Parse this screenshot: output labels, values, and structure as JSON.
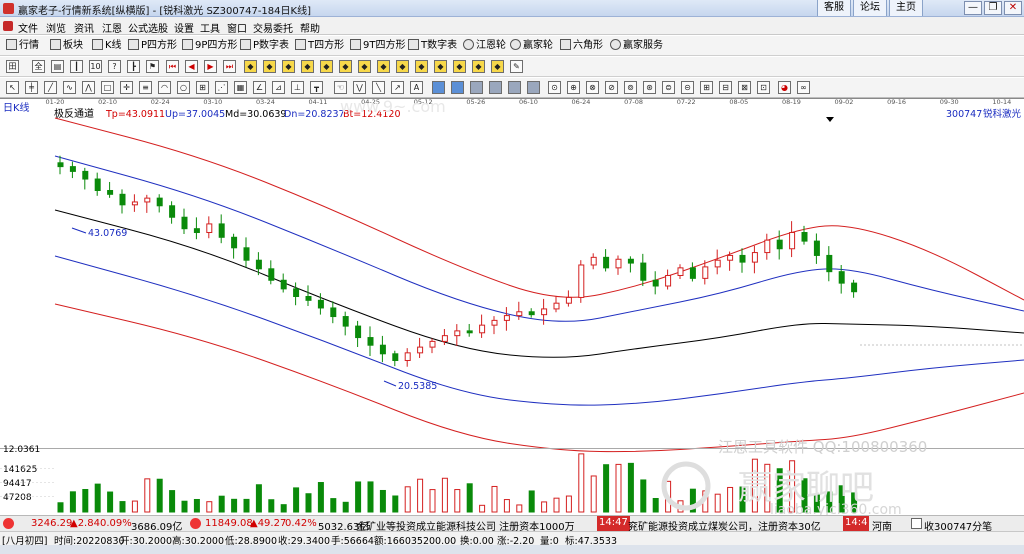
{
  "titlebar": {
    "title": "赢家老子-行情新系统[纵横版] - [锐科激光 SZ300747-184日K线]",
    "buttons": [
      "客服",
      "论坛",
      "主页"
    ],
    "win_min": "—",
    "win_restore": "❐",
    "win_close": "✕"
  },
  "menu": [
    "文件",
    "浏览",
    "资讯",
    "江恩",
    "公式选股",
    "设置",
    "工具",
    "窗口",
    "交易委托",
    "帮助"
  ],
  "toolbar1": [
    "行情",
    "板块",
    "K线",
    "P四方形",
    "9P四方形",
    "P数字表",
    "T四方形",
    "9T四方形",
    "T数字表",
    "江恩轮",
    "赢家轮",
    "六角形",
    "赢家服务"
  ],
  "toolbar2_text": [
    "全",
    "10",
    "?"
  ],
  "toolbar3_text": [
    "∞"
  ],
  "chart_header": {
    "period": "日K线",
    "indicator": "极反通道",
    "tp": "Tp=43.0911",
    "up": "Up=37.0045",
    "md": "Md=30.0639",
    "dn": "Dn=20.8237",
    "bt": "Bt=12.4120",
    "code": "300747",
    "name": "锐科激光"
  },
  "chart_data": {
    "type": "candlestick",
    "dates": [
      "01-20",
      "02-10",
      "02-24",
      "03-10",
      "03-24",
      "04-11",
      "04-25",
      "05-12",
      "05-26",
      "06-10",
      "06-24",
      "07-08",
      "07-22",
      "08-05",
      "08-19",
      "09-02",
      "09-16",
      "09-30",
      "10-14"
    ],
    "price_labels": [
      "43.0769",
      "20.5385"
    ],
    "high_marker": 43.0769,
    "low_marker": 20.5385,
    "price_axis_label": "12.0361",
    "volume_axis_labels": [
      "141625",
      "94417",
      "47208"
    ],
    "close_trend": [
      41.5,
      41.0,
      40.2,
      39.0,
      38.6,
      37.5,
      37.8,
      38.2,
      37.4,
      36.2,
      35.0,
      34.6,
      35.5,
      34.1,
      33.0,
      31.7,
      30.8,
      29.6,
      28.7,
      27.9,
      27.5,
      26.7,
      25.8,
      24.8,
      23.6,
      22.8,
      21.9,
      21.2,
      22.0,
      22.6,
      23.2,
      23.8,
      24.3,
      24.1,
      24.9,
      25.4,
      25.9,
      26.3,
      26.0,
      26.6,
      27.2,
      27.8,
      31.2,
      32.0,
      30.9,
      31.8,
      31.4,
      29.6,
      29.0,
      30.1,
      30.9,
      29.8,
      31.0,
      31.7,
      32.2,
      31.5,
      32.5,
      33.8,
      32.9,
      34.6,
      33.7,
      32.2,
      30.5,
      29.3,
      28.4
    ],
    "channels": {
      "tp": "red",
      "up": "blue",
      "md": "black",
      "dn": "blue",
      "bt": "red"
    }
  },
  "watermark": {
    "line1": "江恩工具软件 QQ:100800360",
    "line2": "赢家聊吧",
    "line3": "liaoba.yjcl360.com",
    "top": "www.9~.com"
  },
  "status": {
    "sh": "3246.29",
    "sh_chg": "▲2.84",
    "sh_pct": "0.09%",
    "sh_amt": "3686.09亿",
    "sz": "11849.08",
    "sz_chg": "▲49.27",
    "sz_pct": "0.42%",
    "sz_amt": "5032.63亿",
    "news1": "金矿业等投资成立能源科技公司 注册资本1000万",
    "time1": "14:47",
    "news2": "兖矿能源投资成立煤炭公司，注册资本30亿",
    "time2": "14:4",
    "news3": "河南",
    "right": "收300747分笔"
  },
  "infobar": {
    "lunar": "[八月初四]",
    "time": "时间:20220830",
    "open": "开:30.2000",
    "high": "高:30.2000",
    "low": "低:28.8900",
    "close": "收:29.3400",
    "hand": "手:56664",
    "amount": "额:166035200.00",
    "turnover": "换:0.00",
    "change": "涨:-2.20",
    "vol": "量:0",
    "mark": "标:47.3533"
  }
}
